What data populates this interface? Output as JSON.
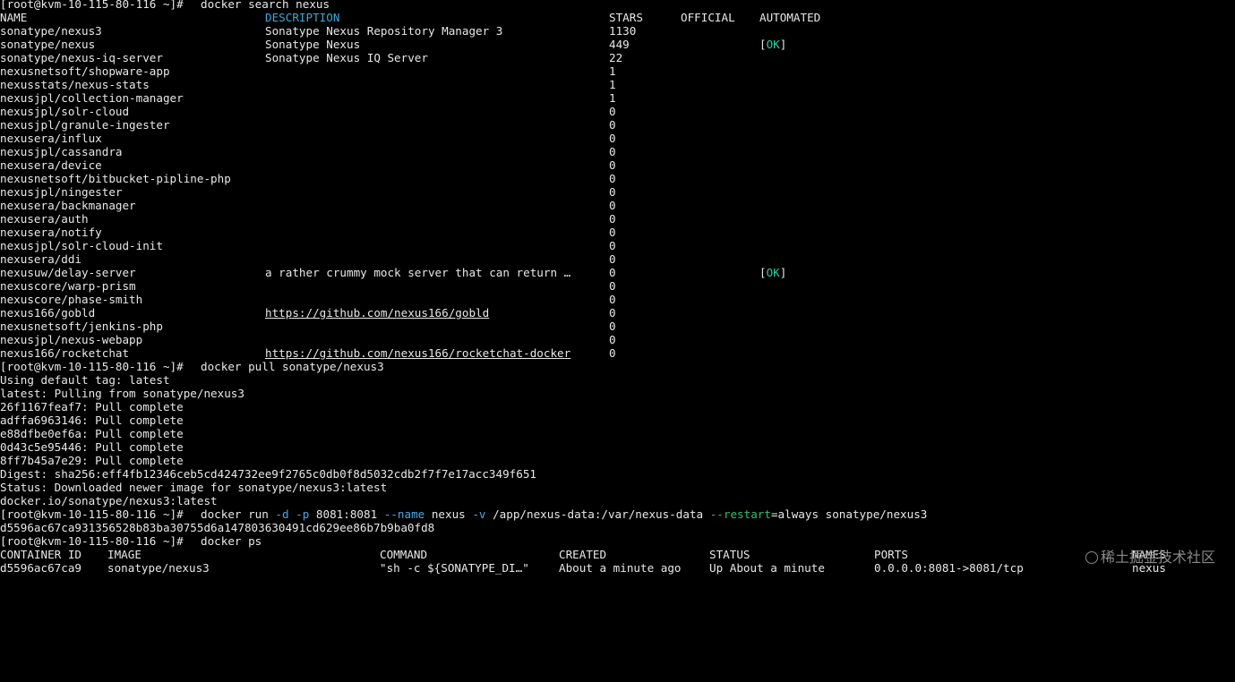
{
  "prompt": "[root@kvm-10-115-80-116 ~]# ",
  "commands": {
    "search": "docker search nexus",
    "pull": "docker pull sonatype/nexus3",
    "run": {
      "base": "docker run ",
      "flag_d": "-d",
      "space1": " ",
      "flag_p": "-p",
      "p_val": " 8081:8081 ",
      "flag_name": "--name",
      "name_val": " nexus ",
      "flag_v": "-v",
      "v_val": " /app/nexus-data:/var/nexus-data ",
      "flag_restart": "--restart",
      "restart_val": "=always sonatype/nexus3"
    },
    "ps": "docker ps"
  },
  "search_headers": {
    "name": "NAME",
    "description": "DESCRIPTION",
    "stars": "STARS",
    "official": "OFFICIAL",
    "automated": "AUTOMATED"
  },
  "search_rows": [
    {
      "name": "sonatype/nexus3",
      "description": "Sonatype Nexus Repository Manager 3",
      "stars": "1130",
      "automated": ""
    },
    {
      "name": "sonatype/nexus",
      "description": "Sonatype Nexus",
      "stars": "449",
      "automated": "[OK]"
    },
    {
      "name": "sonatype/nexus-iq-server",
      "description": "Sonatype Nexus IQ Server",
      "stars": "22",
      "automated": ""
    },
    {
      "name": "nexusnetsoft/shopware-app",
      "description": "",
      "stars": "1",
      "automated": ""
    },
    {
      "name": "nexusstats/nexus-stats",
      "description": "",
      "stars": "1",
      "automated": ""
    },
    {
      "name": "nexusjpl/collection-manager",
      "description": "",
      "stars": "1",
      "automated": ""
    },
    {
      "name": "nexusjpl/solr-cloud",
      "description": "",
      "stars": "0",
      "automated": ""
    },
    {
      "name": "nexusjpl/granule-ingester",
      "description": "",
      "stars": "0",
      "automated": ""
    },
    {
      "name": "nexusera/influx",
      "description": "",
      "stars": "0",
      "automated": ""
    },
    {
      "name": "nexusjpl/cassandra",
      "description": "",
      "stars": "0",
      "automated": ""
    },
    {
      "name": "nexusera/device",
      "description": "",
      "stars": "0",
      "automated": ""
    },
    {
      "name": "nexusnetsoft/bitbucket-pipline-php",
      "description": "",
      "stars": "0",
      "automated": ""
    },
    {
      "name": "nexusjpl/ningester",
      "description": "",
      "stars": "0",
      "automated": ""
    },
    {
      "name": "nexusera/backmanager",
      "description": "",
      "stars": "0",
      "automated": ""
    },
    {
      "name": "nexusera/auth",
      "description": "",
      "stars": "0",
      "automated": ""
    },
    {
      "name": "nexusera/notify",
      "description": "",
      "stars": "0",
      "automated": ""
    },
    {
      "name": "nexusjpl/solr-cloud-init",
      "description": "",
      "stars": "0",
      "automated": ""
    },
    {
      "name": "nexusera/ddi",
      "description": "",
      "stars": "0",
      "automated": ""
    },
    {
      "name": "nexusuw/delay-server",
      "description": "a rather crummy mock server that can return …",
      "stars": "0",
      "automated": "[OK]"
    },
    {
      "name": "nexuscore/warp-prism",
      "description": "",
      "stars": "0",
      "automated": ""
    },
    {
      "name": "nexuscore/phase-smith",
      "description": "",
      "stars": "0",
      "automated": ""
    },
    {
      "name": "nexus166/gobld",
      "description": "https://github.com/nexus166/gobld",
      "stars": "0",
      "automated": "",
      "link": true
    },
    {
      "name": "nexusnetsoft/jenkins-php",
      "description": "",
      "stars": "0",
      "automated": ""
    },
    {
      "name": "nexusjpl/nexus-webapp",
      "description": "",
      "stars": "0",
      "automated": ""
    },
    {
      "name": "nexus166/rocketchat",
      "description": "https://github.com/nexus166/rocketchat-docker",
      "stars": "0",
      "automated": "",
      "link": true
    }
  ],
  "pull_output": [
    "Using default tag: latest",
    "latest: Pulling from sonatype/nexus3",
    "26f1167feaf7: Pull complete",
    "adffa6963146: Pull complete",
    "e88dfbe0ef6a: Pull complete",
    "0d43c5e95446: Pull complete",
    "8ff7b45a7e29: Pull complete",
    "Digest: sha256:eff4fb12346ceb5cd424732ee9f2765c0db0f8d5032cdb2f7f7e17acc349f651",
    "Status: Downloaded newer image for sonatype/nexus3:latest",
    "docker.io/sonatype/nexus3:latest"
  ],
  "run_output": "d5596ac67ca931356528b83ba30755d6a147803630491cd629ee86b7b9ba0fd8",
  "ps_headers": {
    "container_id": "CONTAINER ID",
    "image": "IMAGE",
    "command": "COMMAND",
    "created": "CREATED",
    "status": "STATUS",
    "ports": "PORTS",
    "names": "NAMES"
  },
  "ps_row": {
    "container_id": "d5596ac67ca9",
    "image": "sonatype/nexus3",
    "command": "\"sh -c ${SONATYPE_DI…\"",
    "created": "About a minute ago",
    "status": "Up About a minute",
    "ports": "0.0.0.0:8081->8081/tcp",
    "names": "nexus"
  },
  "watermark": "稀土掘金技术社区",
  "colors": {
    "background": "#000000",
    "text": "#e8e8e8",
    "header_blue": "#3fa9d6",
    "ok_green": "#27d1a2",
    "flag_blue": "#4aa8e0",
    "flag_green": "#2fbf6f"
  }
}
